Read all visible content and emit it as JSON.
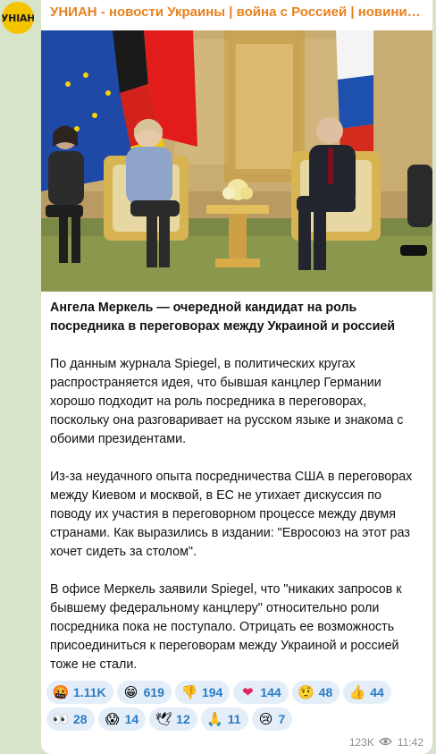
{
  "channel": {
    "avatar_text": "УНІАН",
    "title": "УНИАН - новости Украины | война с Россией | новини Україні..."
  },
  "post": {
    "headline": "Ангела Меркель — очередной кандидат на роль посредника в переговорах между Украиной и россией",
    "paragraphs": [
      "По данным журнала Spiegel, в политических кругах распространяется идея, что бывшая канцлер Германии хорошо подходит на роль посредника в переговорах, поскольку она разговаривает на русском языке и знакома с обоими президентами.",
      "Из-за неудачного опыта посредничества США в переговорах между Киевом и москвой, в ЕС не утихает дискуссия по поводу их участия в переговорном процессе между двумя странами. Как выразились в издании: \"Евросоюз на этот раз хочет сидеть за столом\".",
      "В офисе Меркель заявили Spiegel, что \"никаких запросов к бывшему федеральному канцлеру\" относительно роли посредника пока не поступало. Отрицать ее возможность присоединиться к переговорам между Украиной и россией тоже не стали."
    ]
  },
  "reactions": {
    "row1": [
      {
        "emoji": "🤬",
        "icon": "angry-face-icon",
        "count": "1.11K"
      },
      {
        "emoji": "😁",
        "icon": "grinning-face-icon",
        "count": "619"
      },
      {
        "emoji": "👎",
        "icon": "thumbs-down-icon",
        "count": "194"
      },
      {
        "emoji": "❤",
        "icon": "heart-icon",
        "count": "144"
      },
      {
        "emoji": "🤨",
        "icon": "raised-eyebrow-icon",
        "count": "48"
      },
      {
        "emoji": "👍",
        "icon": "thumbs-up-icon",
        "count": "44"
      }
    ],
    "row2": [
      {
        "emoji": "👀",
        "icon": "eyes-icon",
        "count": "28"
      },
      {
        "emoji": "😱",
        "icon": "screaming-face-icon",
        "count": "14"
      },
      {
        "emoji": "🕊",
        "icon": "dove-icon",
        "count": "12"
      },
      {
        "emoji": "🙏",
        "icon": "folded-hands-icon",
        "count": "11"
      },
      {
        "emoji": "😢",
        "icon": "crying-face-icon",
        "count": "7"
      }
    ]
  },
  "meta": {
    "views": "123K",
    "time": "11:42"
  },
  "colors": {
    "background": "#d7e4c9",
    "title": "#e8811e",
    "reaction_bg": "#e4eef9",
    "reaction_text": "#2b7bc4",
    "meta": "#8a8f96"
  }
}
